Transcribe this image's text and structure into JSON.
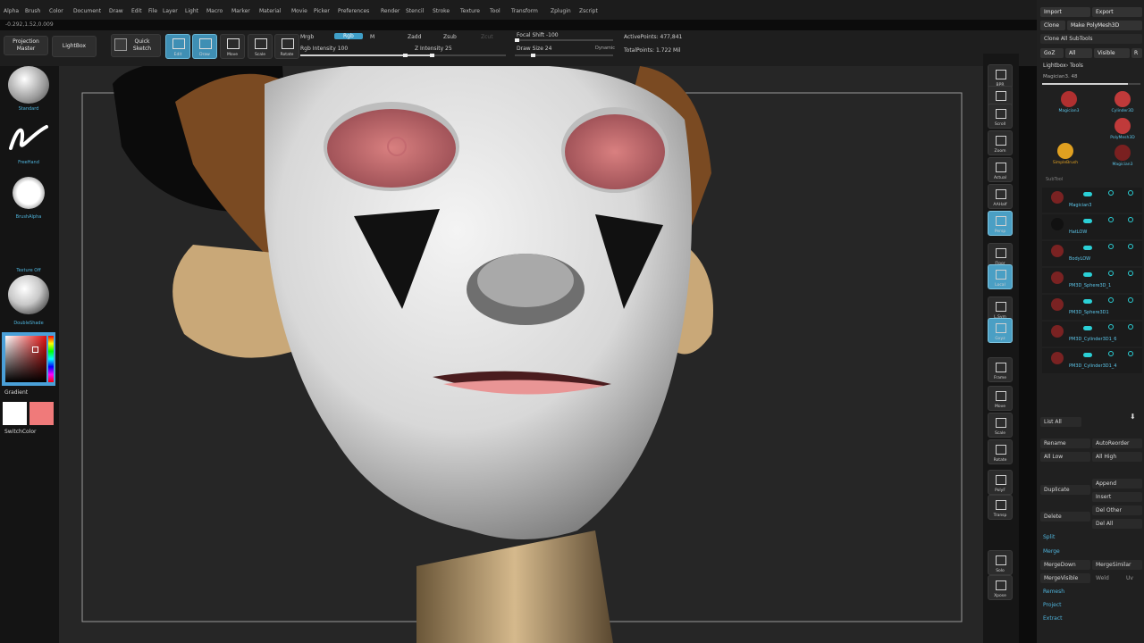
{
  "menu": [
    "Alpha",
    "Brush",
    "Color",
    "Document",
    "Draw",
    "Edit",
    "File",
    "Layer",
    "Light",
    "Macro",
    "Marker",
    "Material",
    "Movie",
    "Picker",
    "Preferences",
    "Render",
    "Stencil",
    "Stroke",
    "Texture",
    "Tool",
    "Transform",
    "Zplugin",
    "Zscript"
  ],
  "coords": "-0.292,1.52,0.009",
  "shelf": {
    "projection_master": "Projection Master",
    "lightbox": "LightBox",
    "quick_sketch": "Quick Sketch",
    "tools": [
      {
        "name": "edit",
        "caption": "Edit",
        "active": true
      },
      {
        "name": "draw",
        "caption": "Draw",
        "active": true
      },
      {
        "name": "move",
        "caption": "Move",
        "active": false
      },
      {
        "name": "scale",
        "caption": "Scale",
        "active": false
      },
      {
        "name": "rotate",
        "caption": "Rotate",
        "active": false
      }
    ],
    "mrgb": "Mrgb",
    "rgb": "Rgb",
    "m": "M",
    "rgb_intensity": "Rgb Intensity 100",
    "rgb_intensity_value": 100,
    "zadd": "Zadd",
    "zsub": "Zsub",
    "zcut": "Zcut",
    "z_intensity": "Z Intensity 25",
    "z_intensity_value": 25,
    "focal_shift": "Focal Shift -100",
    "draw_size": "Draw Size 24",
    "dynamic": "Dynamic",
    "active_points": "ActivePoints: 477,841",
    "total_points": "TotalPoints: 1.722 Mil"
  },
  "left": {
    "brush_caption": "Standard",
    "stroke_caption": "FreeHand",
    "alpha_caption": "BrushAlpha",
    "texture_caption": "Texture Off",
    "material_caption": "DoubleShade",
    "gradient": "Gradient",
    "switch_color": "SwitchColor",
    "main_color": "#ffffff",
    "secondary_color": "#f07a7a"
  },
  "right_column": [
    {
      "caption": "BPR"
    },
    {
      "caption": "SPix 3"
    },
    {
      "caption": "Scroll"
    },
    {
      "caption": "Zoom"
    },
    {
      "caption": "Actual"
    },
    {
      "caption": "AAHalf"
    },
    {
      "caption": "Persp"
    },
    {
      "caption": "Floor"
    },
    {
      "caption": "Local"
    },
    {
      "caption": "L.Sym"
    },
    {
      "caption": "Gxyz"
    },
    {
      "caption": "Frame"
    },
    {
      "caption": "Move"
    },
    {
      "caption": "Scale"
    },
    {
      "caption": "Rotate"
    },
    {
      "caption": "PolyF"
    },
    {
      "caption": "Transp"
    },
    {
      "caption": "Solo"
    },
    {
      "caption": "Xpose"
    }
  ],
  "tray": {
    "import": "Import",
    "export": "Export",
    "clone": "Clone",
    "make_polymesh": "Make PolyMesh3D",
    "clone_all": "Clone All SubTools",
    "goz": "GoZ",
    "all": "All",
    "visible": "Visible",
    "r": "R",
    "lightbox_tools": "Lightbox› Tools",
    "magician_slider": "Magician3. 48",
    "thumbs": [
      {
        "name": "Magician3",
        "color": "#b03030"
      },
      {
        "name": "Cylinder3D",
        "color": "#c03a3a"
      },
      {
        "name": "PolyMesh3D",
        "color": "#c03a3a"
      },
      {
        "name": "SimpleBrush",
        "color": "#e0a020"
      },
      {
        "name": "Magician3",
        "color": "#7a2020"
      }
    ],
    "subtool_label": "SubTool",
    "subtools": [
      "Magician3",
      "HatLOW",
      "BodyLOW",
      "PM3D_Sphere3D_1",
      "PM3D_Sphere3D1",
      "PM3D_Cylinder3D1_6",
      "PM3D_Cylinder3D1_4"
    ],
    "list_all": "List All",
    "rename": "Rename",
    "auto_reorder": "AutoReorder",
    "all_low": "All Low",
    "all_high": "All High",
    "append": "Append",
    "duplicate": "Duplicate",
    "insert": "Insert",
    "delete": "Delete",
    "del_other": "Del Other",
    "del_all": "Del All",
    "split": "Split",
    "merge": "Merge",
    "merge_down": "MergeDown",
    "merge_similar": "MergeSimilar",
    "merge_visible": "MergeVisible",
    "weld": "Weld",
    "uv": "Uv",
    "remesh": "Remesh",
    "project": "Project",
    "extract": "Extract"
  }
}
